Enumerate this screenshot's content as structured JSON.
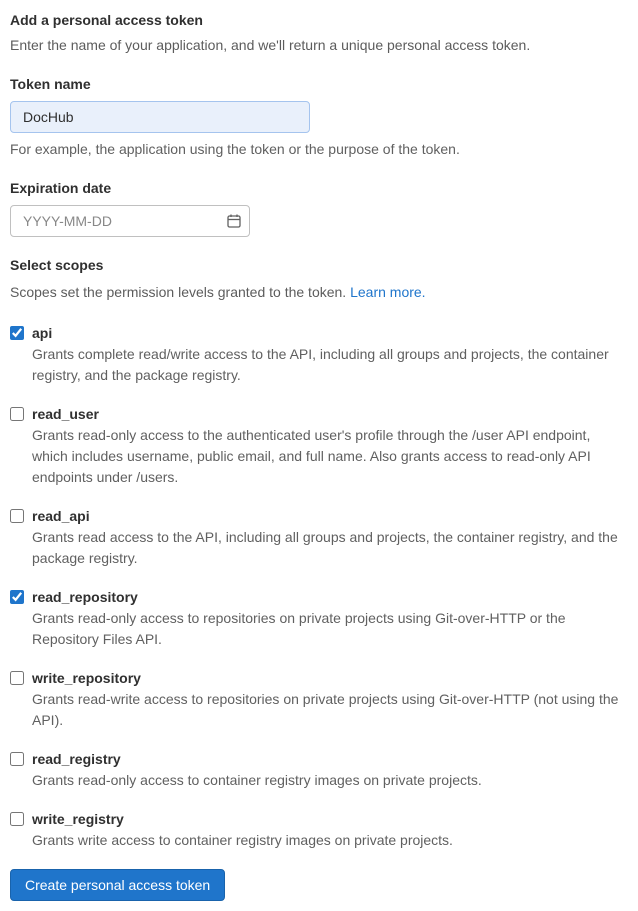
{
  "heading": "Add a personal access token",
  "intro": "Enter the name of your application, and we'll return a unique personal access token.",
  "token_name": {
    "label": "Token name",
    "value": "DocHub",
    "helper": "For example, the application using the token or the purpose of the token."
  },
  "expiration": {
    "label": "Expiration date",
    "placeholder": "YYYY-MM-DD"
  },
  "scopes_section": {
    "label": "Select scopes",
    "helper_prefix": "Scopes set the permission levels granted to the token. ",
    "learn_more": "Learn more."
  },
  "scopes": [
    {
      "name": "api",
      "checked": true,
      "desc": "Grants complete read/write access to the API, including all groups and projects, the container registry, and the package registry."
    },
    {
      "name": "read_user",
      "checked": false,
      "desc": "Grants read-only access to the authenticated user's profile through the /user API endpoint, which includes username, public email, and full name. Also grants access to read-only API endpoints under /users."
    },
    {
      "name": "read_api",
      "checked": false,
      "desc": "Grants read access to the API, including all groups and projects, the container registry, and the package registry."
    },
    {
      "name": "read_repository",
      "checked": true,
      "desc": "Grants read-only access to repositories on private projects using Git-over-HTTP or the Repository Files API."
    },
    {
      "name": "write_repository",
      "checked": false,
      "desc": "Grants read-write access to repositories on private projects using Git-over-HTTP (not using the API)."
    },
    {
      "name": "read_registry",
      "checked": false,
      "desc": "Grants read-only access to container registry images on private projects."
    },
    {
      "name": "write_registry",
      "checked": false,
      "desc": "Grants write access to container registry images on private projects."
    }
  ],
  "submit_label": "Create personal access token"
}
